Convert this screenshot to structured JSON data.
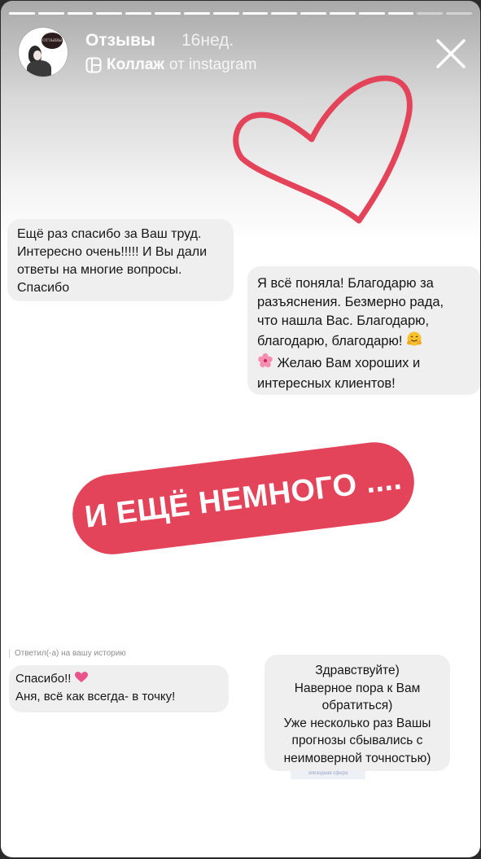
{
  "story": {
    "progress_total": 16,
    "progress_done": 14
  },
  "header": {
    "title": "Отзывы",
    "time": "16нед.",
    "subtitle_bold": "Коллаж",
    "subtitle_from": "от instagram",
    "avatar_tag": "ОТЗЫВЫ"
  },
  "messages": {
    "m1": [
      "Ещё раз спасибо за Ваш труд.",
      "Интересно очень!!!!! И Вы дали",
      "ответы на многие вопросы.",
      "Спасибо"
    ],
    "m2_lines": [
      "Я всё поняла! Благодарю за",
      "разъяснения. Безмерно рада,",
      "что нашла Вас. Благодарю,"
    ],
    "m2_line4": "благодарю, благодарю!",
    "m2_line5": "Желаю Вам хороших и",
    "m2_line6": "интересных клиентов!",
    "replied_label": "Ответил(-а) на вашу историю",
    "m3_line1": "Спасибо!!",
    "m3_line2": "Аня, всё как всегда- в точку!",
    "m4": [
      "Здравствуйте)",
      "Наверное пора к Вам",
      "обратиться)",
      "Уже несколько раз Вашы",
      "прогнозы сбывались с",
      "неимоверной точностью)"
    ],
    "tiny_caption": "эпизодная сфера"
  },
  "banner": {
    "text": "И ЕЩЁ НЕМНОГО ...."
  },
  "icons": {
    "close": "close-icon",
    "heart": "heart-icon",
    "collage": "collage-icon",
    "hugging": "hugging-face-emoji",
    "flower": "cherry-blossom-emoji",
    "small_heart": "heart-emoji"
  },
  "colors": {
    "accent": "#e4445a",
    "bubble": "#efefef"
  }
}
